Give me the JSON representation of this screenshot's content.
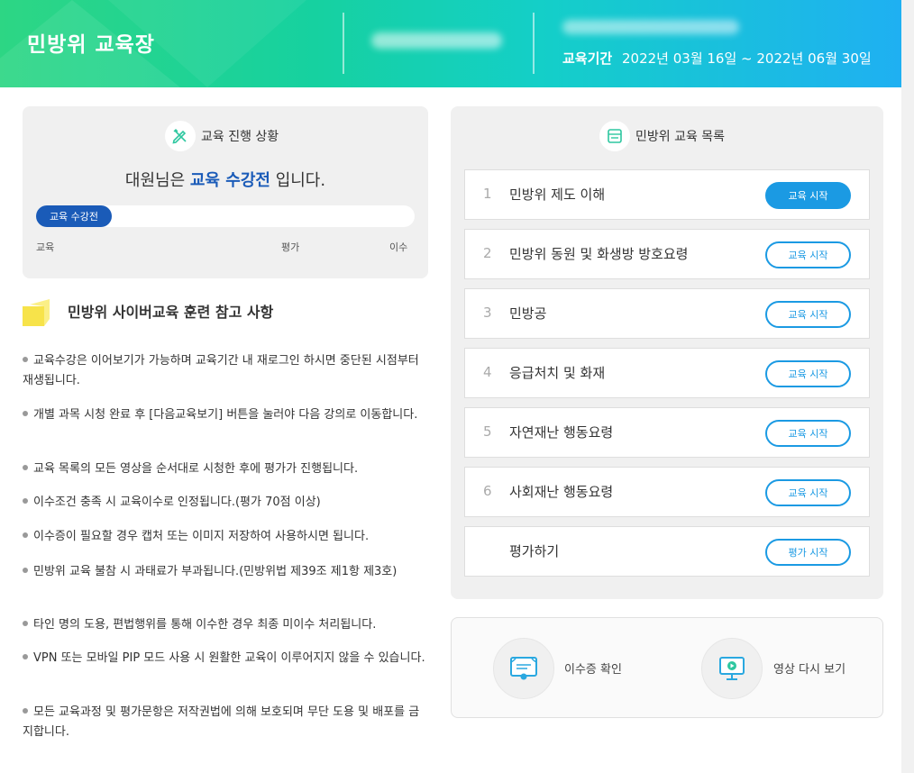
{
  "header": {
    "title": "민방위 교육장",
    "period_label": "교육기간",
    "period_value": "2022년 03월 16일 ~ 2022년 06월 30일"
  },
  "progress": {
    "heading": "교육 진행 상황",
    "status_prefix": "대원님은",
    "status_highlight": "교육 수강전",
    "status_suffix": "입니다.",
    "bar_label": "교육 수강전",
    "steps": [
      "교육",
      "평가",
      "이수"
    ]
  },
  "notes": {
    "title": "민방위 사이버교육 훈련 참고 사항",
    "items": [
      "교육수강은 이어보기가 가능하며 교육기간 내 재로그인 하시면 중단된 시점부터 재생됩니다.",
      "개별 과목 시청 완료 후 [다음교육보기] 버튼을 눌러야 다음 강의로 이동합니다.",
      "교육 목록의 모든 영상을 순서대로 시청한 후에 평가가 진행됩니다.",
      "이수조건 충족 시 교육이수로 인정됩니다.(평가 70점 이상)",
      "이수증이 필요할 경우 캡처 또는 이미지 저장하여 사용하시면 됩니다.",
      "민방위 교육 불참 시 과태료가 부과됩니다.(민방위법 제39조 제1항 제3호)",
      "타인 명의 도용, 편법행위를 통해 이수한 경우 최종 미이수 처리됩니다.",
      "VPN 또는 모바일 PIP 모드 사용 시 원활한 교육이 이루어지지 않을 수 있습니다.",
      "모든 교육과정 및 평가문항은 저작권법에 의해 보호되며 무단 도용 및 배포를 금지합니다."
    ]
  },
  "course_list": {
    "heading": "민방위 교육 목록",
    "items": [
      {
        "num": "1",
        "label": "민방위 제도 이해",
        "button": "교육 시작"
      },
      {
        "num": "2",
        "label": "민방위 동원 및 화생방 방호요령",
        "button": "교육 시작"
      },
      {
        "num": "3",
        "label": "민방공",
        "button": "교육 시작"
      },
      {
        "num": "4",
        "label": "응급처치 및 화재",
        "button": "교육 시작"
      },
      {
        "num": "5",
        "label": "자연재난 행동요령",
        "button": "교육 시작"
      },
      {
        "num": "6",
        "label": "사회재난 행동요령",
        "button": "교육 시작"
      },
      {
        "num": "",
        "label": "평가하기",
        "button": "평가 시작"
      }
    ]
  },
  "actions": {
    "certificate": "이수증 확인",
    "replay": "영상 다시 보기"
  },
  "colors": {
    "accent": "#1b9ae3",
    "status_blue": "#1a5bb8",
    "header_start": "#2dd684",
    "header_end": "#1fb0f2"
  }
}
